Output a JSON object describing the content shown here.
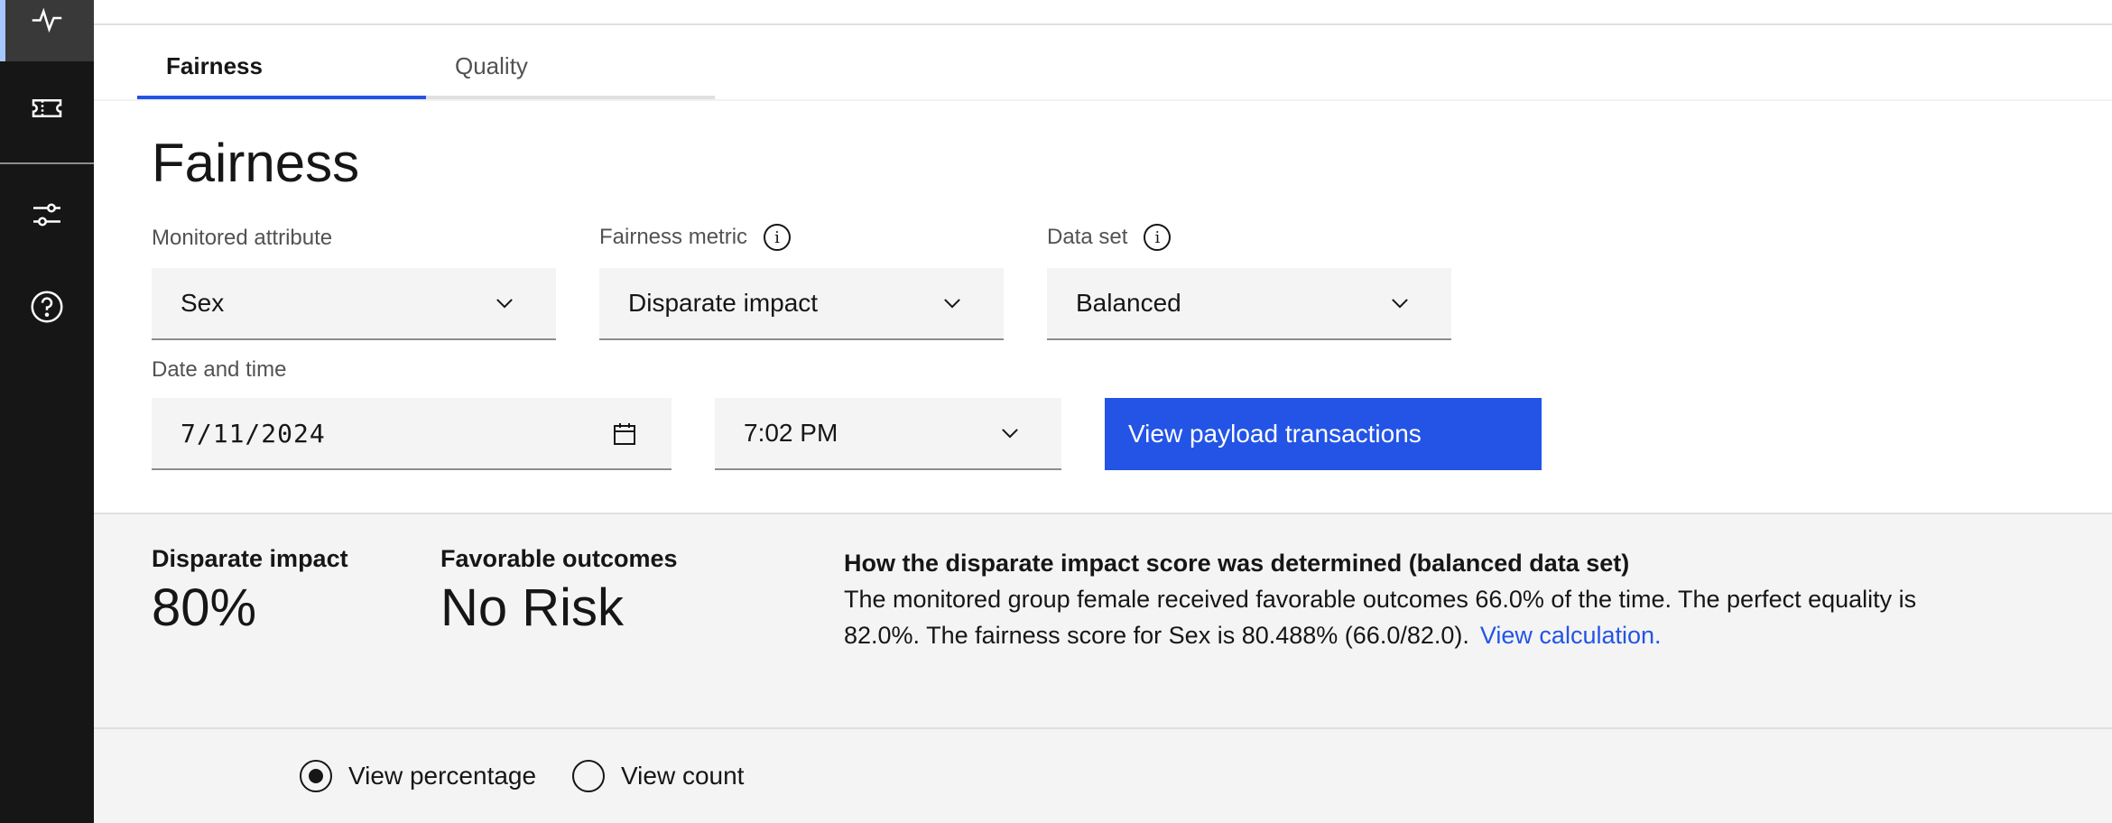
{
  "tabs": [
    {
      "label": "Fairness",
      "active": true
    },
    {
      "label": "Quality",
      "active": false
    }
  ],
  "page_title": "Fairness",
  "filters": {
    "monitored_attribute": {
      "label": "Monitored attribute",
      "value": "Sex"
    },
    "fairness_metric": {
      "label": "Fairness metric",
      "value": "Disparate impact",
      "icon": "info-icon"
    },
    "data_set": {
      "label": "Data set",
      "value": "Balanced",
      "icon": "info-icon"
    },
    "date_time": {
      "label": "Date and time",
      "date": "7/11/2024",
      "time": "7:02 PM"
    }
  },
  "actions": {
    "view_payload": "View payload transactions"
  },
  "summary": {
    "disparate_impact": {
      "label": "Disparate impact",
      "value": "80%"
    },
    "favorable_outcomes": {
      "label": "Favorable outcomes",
      "value": "No Risk"
    },
    "explanation": {
      "title": "How the disparate impact score was determined (balanced data set)",
      "body": "The monitored group female received favorable outcomes 66.0% of the time. The perfect equality is 82.0%. The fairness score for Sex is 80.488% (66.0/82.0).",
      "link": "View calculation."
    }
  },
  "view_mode": {
    "options": [
      {
        "label": "View percentage",
        "selected": true
      },
      {
        "label": "View count",
        "selected": false
      }
    ]
  },
  "sidebar": {
    "icons": [
      "activity-icon",
      "ticket-icon",
      "sliders-icon",
      "help-icon"
    ]
  },
  "colors": {
    "accent": "#2354e6",
    "sidebar": "#161616",
    "panel": "#f4f4f4"
  }
}
